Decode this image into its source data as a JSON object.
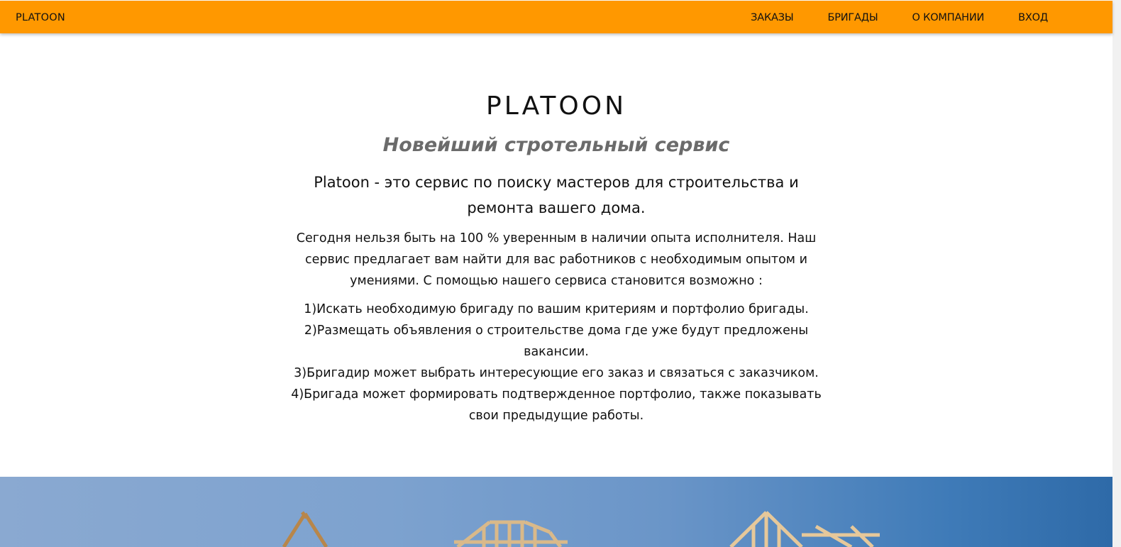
{
  "navbar": {
    "brand": "PLATOON",
    "links": [
      {
        "label": "ЗАКАЗЫ"
      },
      {
        "label": "БРИГАДЫ"
      },
      {
        "label": "О КОМПАНИИ"
      },
      {
        "label": "ВХОД"
      }
    ],
    "background_color": "#ff9800"
  },
  "intro": {
    "title": "PLATOON",
    "subtitle": "Новейший стротельный сервис",
    "lead": "Platoon - это сервис по поиску мастеров для строительства и ремонта вашего дома.",
    "description": "Сегодня нельзя быть на 100 % уверенным в наличии опыта исполнителя. Наш сервис предлагает вам найти для вас работников с необходимым опытом и умениями. С помощью нашего сервиса становится возможно :",
    "features": [
      "1)Искать необходимую бригаду по вашим критериям и портфолио бригады.",
      "2)Размещать объявления о строительстве дома где уже будут предложены вакансии.",
      "3)Бригадир может выбрать интересующие его заказ и связаться с заказчиком.",
      "4)Бригада может формировать подтвержденное портфолио, также показывать свои предыдущие работы."
    ]
  },
  "hero": {
    "image_subject": "wooden-roof-frame-under-blue-sky"
  }
}
